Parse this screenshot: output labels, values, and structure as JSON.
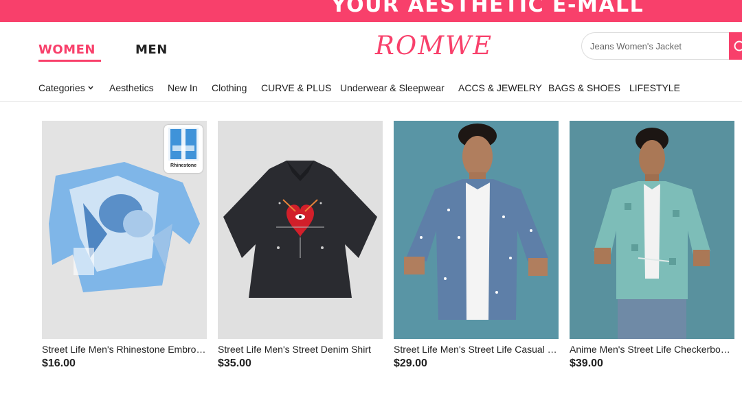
{
  "banner": {
    "text": "YOUR AESTHETIC E-MALL"
  },
  "header": {
    "tabs": [
      "WOMEN",
      "MEN"
    ],
    "logo": "ROMWE",
    "search_placeholder": "Jeans Women's Jacket"
  },
  "nav": {
    "items": [
      "Categories",
      "Aesthetics",
      "New In",
      "Clothing",
      "CURVE & PLUS",
      "Underwear & Sleepwear",
      "ACCS & JEWELRY",
      "BAGS & SHOES",
      "LIFESTYLE"
    ]
  },
  "products": [
    {
      "name": "Street Life Men's Rhinestone Embroidered Tee",
      "price": "$16.00",
      "badge": "Rhinestone"
    },
    {
      "name": "Street Life Men's Street Denim Shirt",
      "price": "$35.00"
    },
    {
      "name": "Street Life Men's Street Life Casual Shirt",
      "price": "$29.00"
    },
    {
      "name": "Anime Men's Street Life Checkerboard Jacket",
      "price": "$39.00"
    }
  ],
  "colors": {
    "brand": "#f8406b",
    "text": "#222222"
  }
}
